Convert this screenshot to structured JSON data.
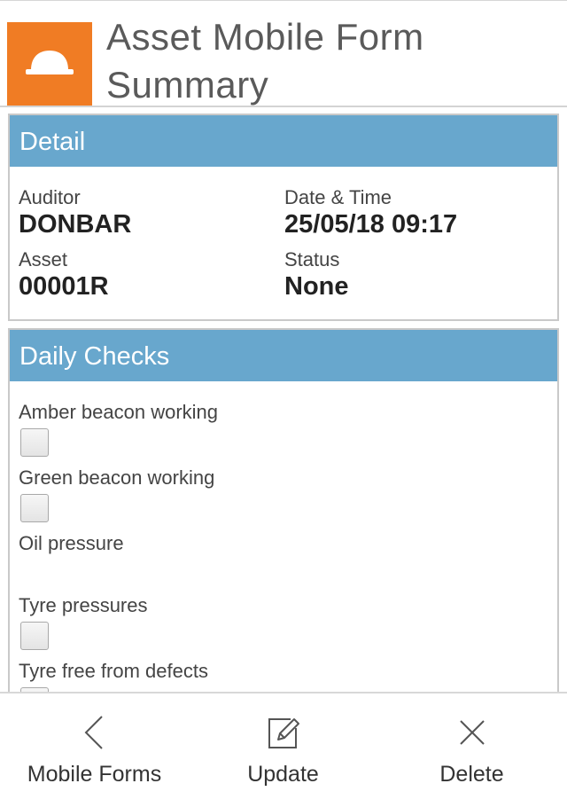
{
  "header": {
    "title_line1": "Asset Mobile Form",
    "title_line2": "Summary",
    "logo_icon": "hard-hat-icon",
    "logo_color": "#f07c24"
  },
  "detail": {
    "heading": "Detail",
    "auditor_label": "Auditor",
    "auditor_value": "DONBAR",
    "datetime_label": "Date & Time",
    "datetime_value": "25/05/18 09:17",
    "asset_label": "Asset",
    "asset_value": "00001R",
    "status_label": "Status",
    "status_value": "None"
  },
  "daily_checks": {
    "heading": "Daily Checks",
    "items": [
      {
        "label": "Amber beacon working",
        "has_checkbox": true,
        "checked": false
      },
      {
        "label": "Green beacon working",
        "has_checkbox": true,
        "checked": false
      },
      {
        "label": "Oil pressure",
        "has_checkbox": false,
        "checked": false
      },
      {
        "label": "Tyre pressures",
        "has_checkbox": true,
        "checked": false
      },
      {
        "label": "Tyre free from defects",
        "has_checkbox": true,
        "checked": false
      }
    ]
  },
  "toolbar": {
    "back_label": "Mobile Forms",
    "back_icon": "chevron-left-icon",
    "update_label": "Update",
    "update_icon": "edit-icon",
    "delete_label": "Delete",
    "delete_icon": "close-icon"
  },
  "colors": {
    "panel_header": "#68a7cd",
    "accent": "#f07c24"
  }
}
